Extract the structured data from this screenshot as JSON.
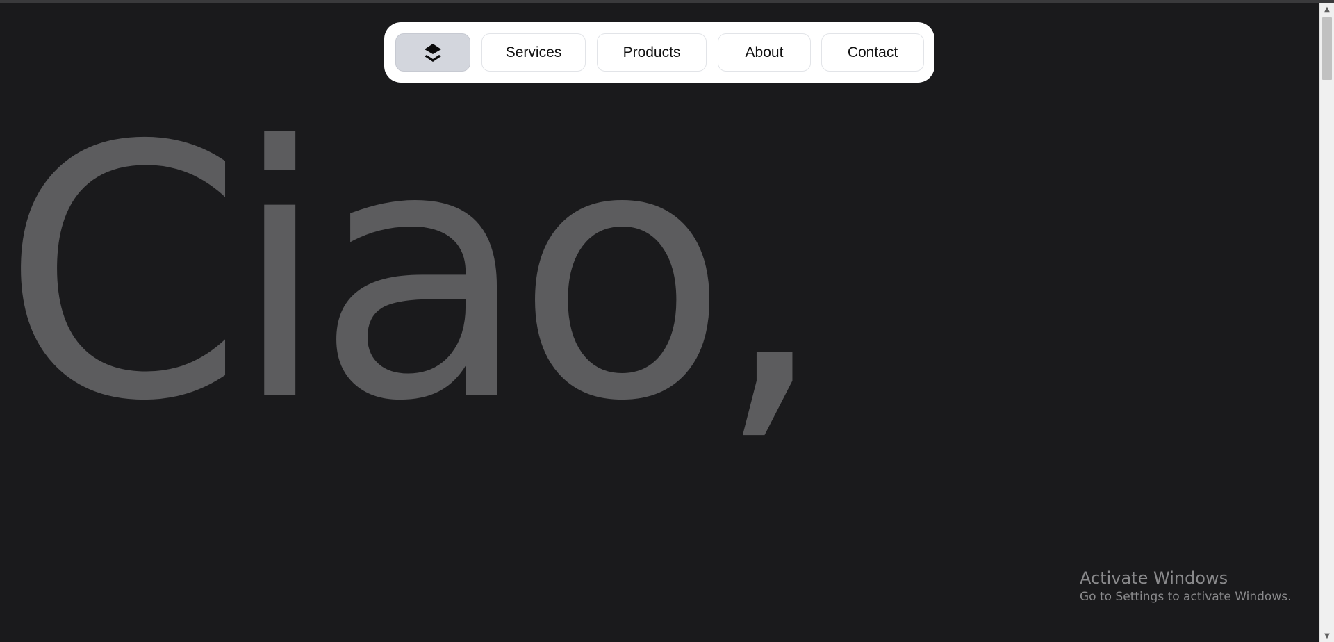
{
  "nav": {
    "home_icon": "layers-icon",
    "items": [
      {
        "label": "Services"
      },
      {
        "label": "Products"
      },
      {
        "label": "About"
      },
      {
        "label": "Contact"
      }
    ]
  },
  "hero": {
    "text": "Ciao,"
  },
  "watermark": {
    "title": "Activate Windows",
    "subtitle": "Go to Settings to activate Windows."
  },
  "colors": {
    "background": "#1a1a1c",
    "hero_text": "#5c5c5e",
    "nav_background": "#ffffff",
    "home_button": "#d3d6dd"
  }
}
